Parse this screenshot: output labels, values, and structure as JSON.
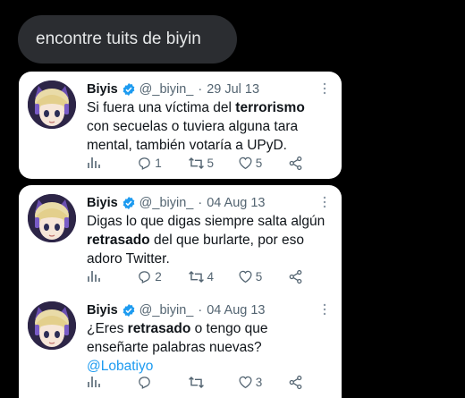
{
  "query": "encontre tuits de biyin",
  "tweets": [
    {
      "name": "Biyis",
      "handle": "@_biyin_",
      "separator": "·",
      "date": "29 Jul 13",
      "text_parts": [
        "Si fuera una víctima del ",
        "terrorismo",
        " con secuelas o tuviera alguna tara mental, también votaría a UPyD."
      ],
      "replies": "1",
      "retweets": "5",
      "likes": "5"
    },
    {
      "name": "Biyis",
      "handle": "@_biyin_",
      "separator": "·",
      "date": "04 Aug 13",
      "text_parts": [
        "Digas lo que digas siempre salta algún ",
        "retrasado",
        " del que burlarte, por eso adoro Twitter."
      ],
      "replies": "2",
      "retweets": "4",
      "likes": "5"
    },
    {
      "name": "Biyis",
      "handle": "@_biyin_",
      "separator": "·",
      "date": "04 Aug 13",
      "text_parts": [
        "¿Eres ",
        "retrasado",
        " o tengo que enseñarte palabras nuevas? ",
        "@Lobatiyo"
      ],
      "replies": "",
      "retweets": "",
      "likes": "3"
    }
  ],
  "icons": {
    "verified": "verified-badge-icon",
    "more": "more-options-icon",
    "views": "views-icon",
    "reply": "reply-icon",
    "retweet": "retweet-icon",
    "like": "like-icon",
    "share": "share-icon"
  },
  "colors": {
    "background": "#000000",
    "bubble": "#2b2d31",
    "verified": "#1d9bf0",
    "mention": "#1d9bf0",
    "muted": "#536471"
  }
}
